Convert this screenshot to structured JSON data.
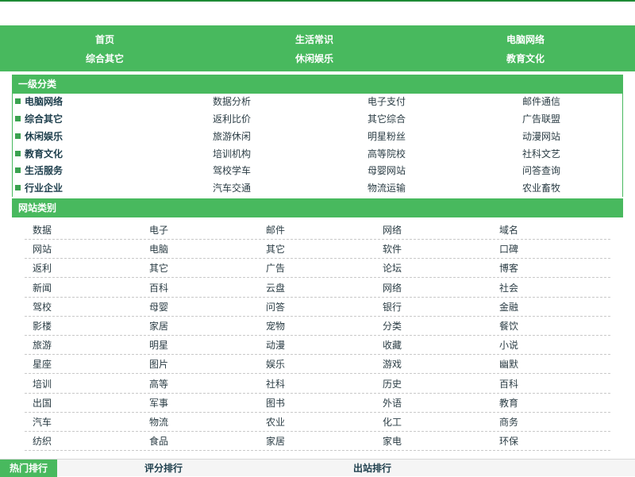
{
  "nav": {
    "row1": [
      "首页",
      "生活常识",
      "电脑网络"
    ],
    "row2": [
      "综合其它",
      "休闲娱乐",
      "教育文化"
    ]
  },
  "category_section": {
    "title": "一级分类",
    "rows": [
      {
        "main": "电脑网络",
        "subs": [
          "数据分析",
          "电子支付",
          "邮件通信"
        ]
      },
      {
        "main": "综合其它",
        "subs": [
          "返利比价",
          "其它综合",
          "广告联盟"
        ]
      },
      {
        "main": "休闲娱乐",
        "subs": [
          "旅游休闲",
          "明星粉丝",
          "动漫网站"
        ]
      },
      {
        "main": "教育文化",
        "subs": [
          "培训机构",
          "高等院校",
          "社科文艺"
        ]
      },
      {
        "main": "生活服务",
        "subs": [
          "驾校学车",
          "母婴网站",
          "问答查询"
        ]
      },
      {
        "main": "行业企业",
        "subs": [
          "汽车交通",
          "物流运输",
          "农业畜牧"
        ]
      }
    ]
  },
  "site_types": {
    "title": "网站类别",
    "rows": [
      [
        "数据",
        "电子",
        "邮件",
        "网络",
        "域名"
      ],
      [
        "网站",
        "电脑",
        "其它",
        "软件",
        "口碑"
      ],
      [
        "返利",
        "其它",
        "广告",
        "论坛",
        "博客"
      ],
      [
        "新闻",
        "百科",
        "云盘",
        "网络",
        "社会"
      ],
      [
        "驾校",
        "母婴",
        "问答",
        "银行",
        "金融"
      ],
      [
        "影楼",
        "家居",
        "宠物",
        "分类",
        "餐饮"
      ],
      [
        "旅游",
        "明星",
        "动漫",
        "收藏",
        "小说"
      ],
      [
        "星座",
        "图片",
        "娱乐",
        "游戏",
        "幽默"
      ],
      [
        "培训",
        "高等",
        "社科",
        "历史",
        "百科"
      ],
      [
        "出国",
        "军事",
        "图书",
        "外语",
        "教育"
      ],
      [
        "汽车",
        "物流",
        "农业",
        "化工",
        "商务"
      ],
      [
        "纺织",
        "食品",
        "家居",
        "家电",
        "环保"
      ]
    ]
  },
  "bottom_tabs": [
    "热门排行",
    "评分排行",
    "出站排行"
  ],
  "colors": {
    "accent": "#48b95e",
    "dark_line": "#1e8a35",
    "text": "#1f3a45"
  }
}
